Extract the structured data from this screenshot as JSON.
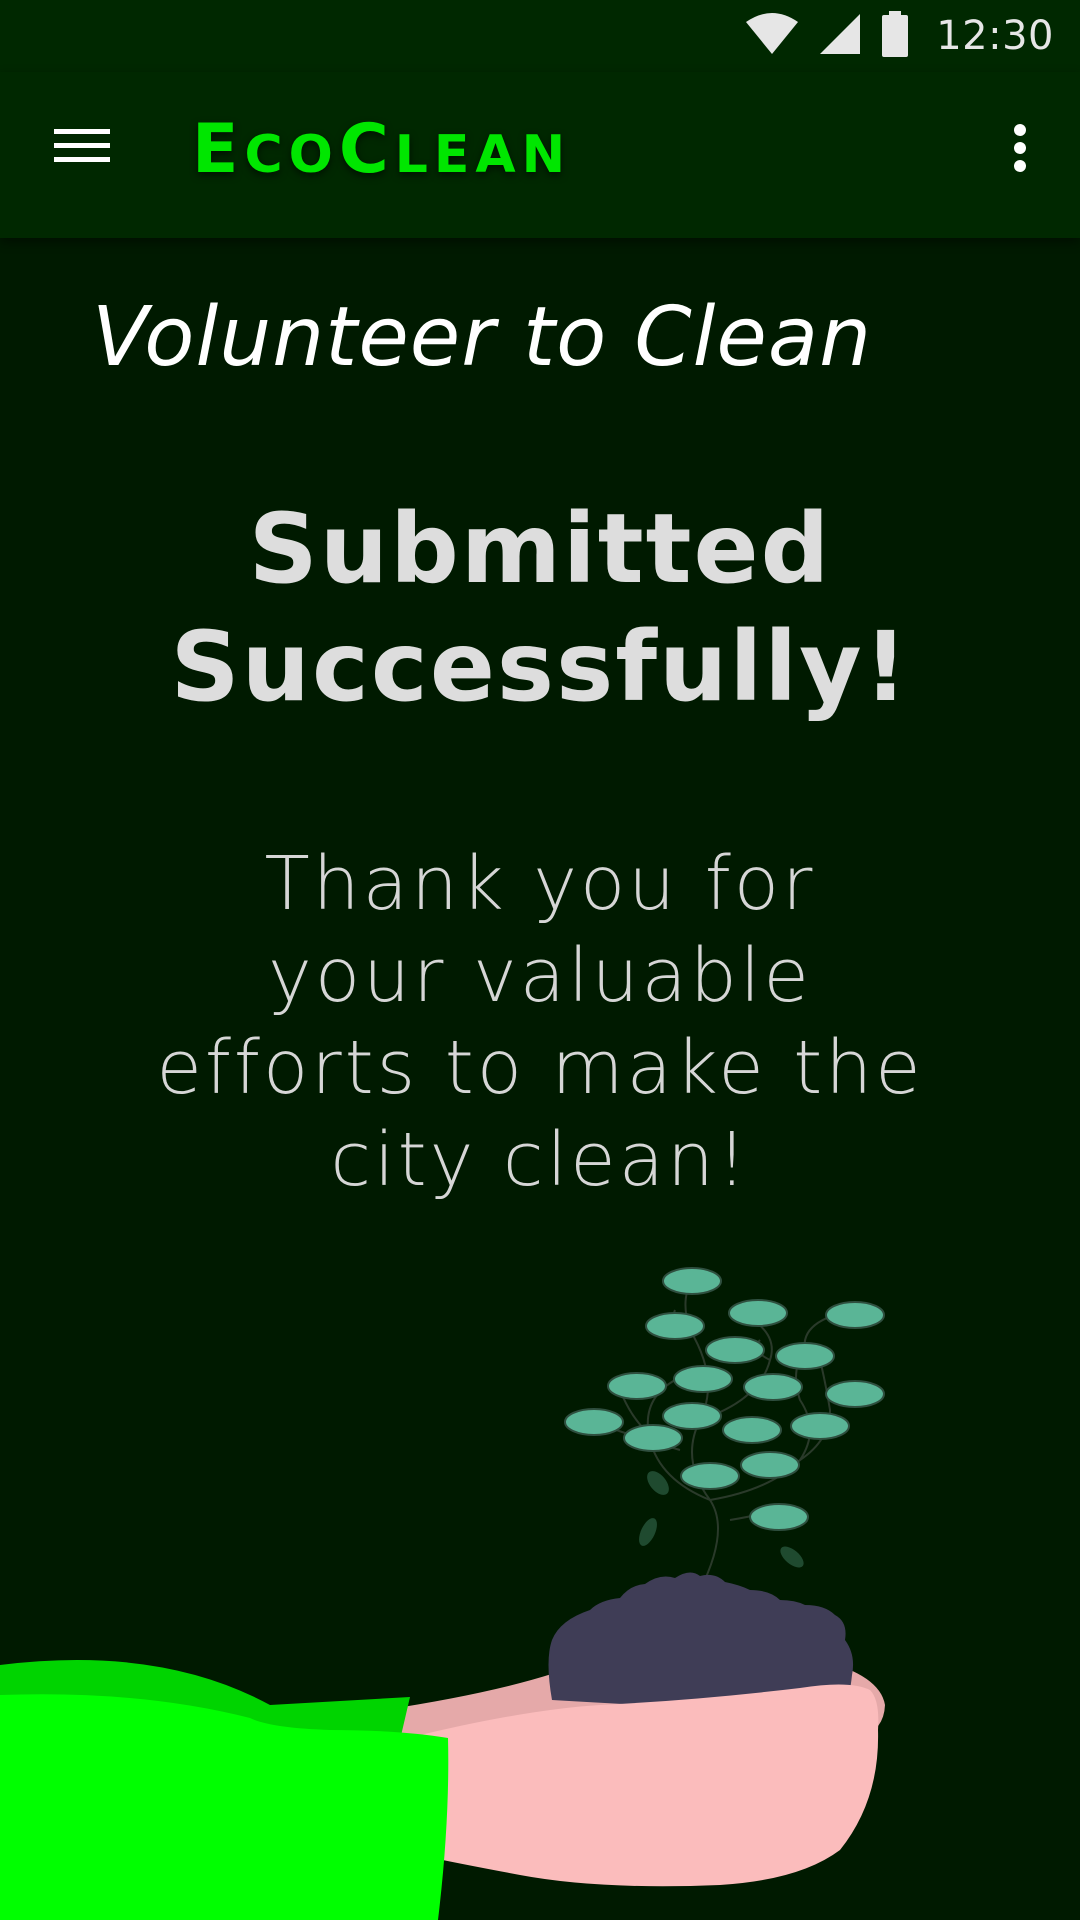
{
  "status_bar": {
    "time": "12:30",
    "icons": [
      "wifi-icon",
      "signal-icon",
      "battery-icon"
    ]
  },
  "app_bar": {
    "title_parts": {
      "e": "E",
      "co": "CO",
      "c": "C",
      "lean": "LEAN"
    },
    "title_text": "EcoClean",
    "menu_icon": "menu-icon",
    "overflow_icon": "more-vert-icon"
  },
  "content": {
    "section_title": "Volunteer to Clean",
    "headline_line1": "Submitted",
    "headline_line2": "Successfully!",
    "message_line1": "Thank you for",
    "message_line2": "your valuable",
    "message_line3": "efforts to make the",
    "message_line4": "city clean!"
  },
  "colors": {
    "background": "#001a00",
    "app_bar": "#002800",
    "brand": "#00e600",
    "sleeve": "#00ff00",
    "hand": "#fbbcbc",
    "soil": "#3f3d56",
    "leaf": "#5ab596"
  }
}
